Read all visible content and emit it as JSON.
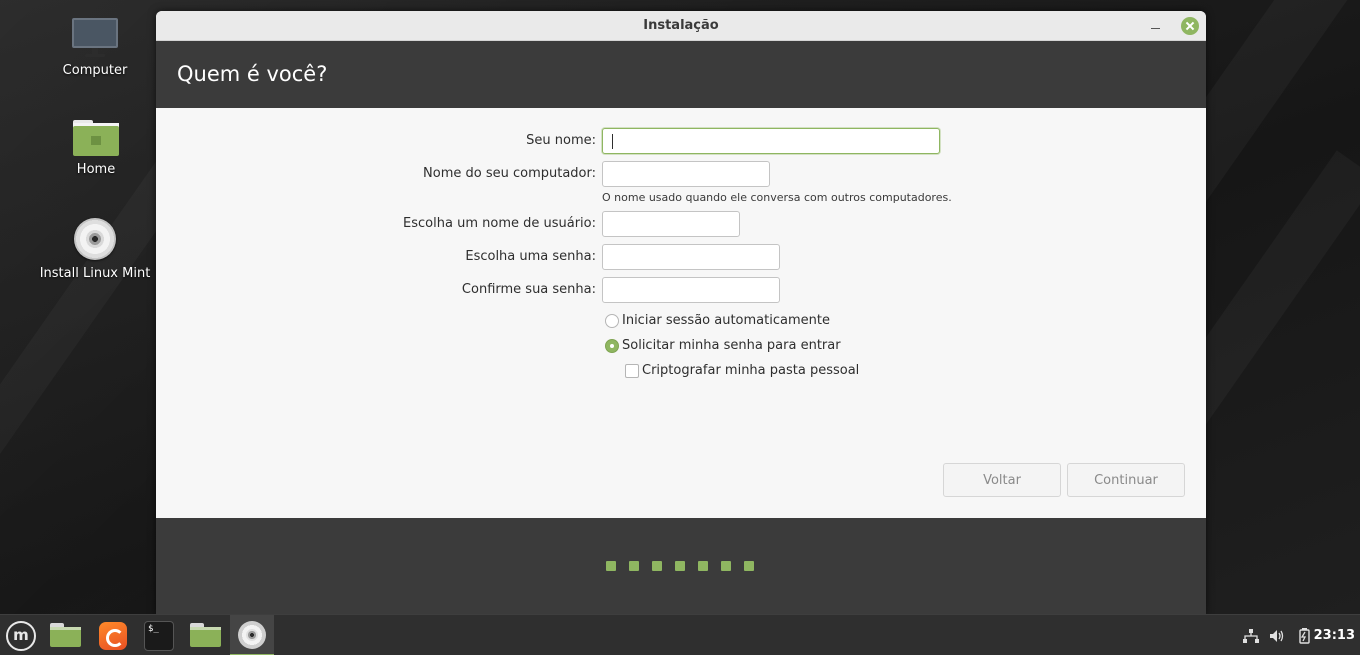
{
  "desktop": {
    "icons": [
      {
        "label": "Computer",
        "icon": "monitor-icon"
      },
      {
        "label": "Home",
        "icon": "home-folder-icon"
      },
      {
        "label": "Install Linux Mint",
        "icon": "disc-icon"
      }
    ]
  },
  "window": {
    "title": "Instalação",
    "header": "Quem é você?"
  },
  "form": {
    "name_label": "Seu nome:",
    "name_value": "",
    "computer_label": "Nome do seu computador:",
    "computer_value": "",
    "computer_hint": "O nome usado quando ele conversa com outros computadores.",
    "username_label": "Escolha um nome de usuário:",
    "username_value": "",
    "password_label": "Escolha uma senha:",
    "password_value": "",
    "confirm_label": "Confirme sua senha:",
    "confirm_value": "",
    "auto_login_label": "Iniciar sessão automaticamente",
    "auto_login_selected": false,
    "require_password_label": "Solicitar minha senha para entrar",
    "require_password_selected": true,
    "encrypt_home_label": "Criptografar minha pasta pessoal",
    "encrypt_home_checked": false
  },
  "buttons": {
    "back": "Voltar",
    "continue": "Continuar"
  },
  "progress": {
    "steps_total": 7
  },
  "colors": {
    "accent": "#8fb661",
    "header_bg": "#3b3b3b"
  },
  "taskbar": {
    "items": [
      "menu-icon",
      "show-desktop-icon",
      "firefox-icon",
      "terminal-icon",
      "files-icon",
      "installer-disc-icon"
    ],
    "tray": [
      "network-icon",
      "volume-icon",
      "battery-icon"
    ],
    "clock": "23:13"
  }
}
